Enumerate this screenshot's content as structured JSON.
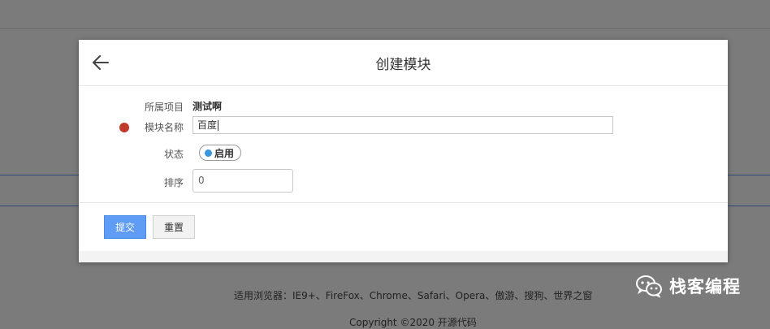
{
  "background": {
    "browser_support": "适用浏览器：IE9+、FireFox、Chrome、Safari、Opera、傲游、搜狗、世界之窗",
    "copyright": "Copyright ©2020 开源代码"
  },
  "watermark": {
    "text": "栈客编程",
    "icon": "wechat-icon"
  },
  "modal": {
    "title": "创建模块",
    "back_icon": "arrow-left-icon",
    "fields": {
      "project_label": "所属项目",
      "project_value": "测试啊",
      "name_label": "模块名称",
      "name_value": "百度",
      "status_label": "状态",
      "status_value": "启用",
      "order_label": "排序",
      "order_value": "0"
    },
    "buttons": {
      "submit": "提交",
      "reset": "重置"
    }
  },
  "colors": {
    "overlay": "#7b7b7b",
    "primary_button": "#5e9cf5",
    "required_dot": "#c0392b",
    "toggle_dot": "#3a96dd"
  }
}
